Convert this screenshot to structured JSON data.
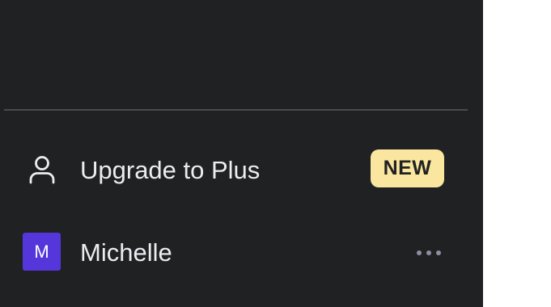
{
  "sidebar": {
    "upgrade": {
      "label": "Upgrade to Plus",
      "badge": "NEW",
      "icon": "user-icon"
    },
    "account": {
      "avatar_initial": "M",
      "name": "Michelle",
      "menu_icon": "ellipsis-icon"
    }
  },
  "colors": {
    "sidebar_bg": "#202123",
    "divider": "#4a4b50",
    "text": "#ececf1",
    "badge_bg": "#fae69e",
    "avatar_bg": "#5436da"
  }
}
